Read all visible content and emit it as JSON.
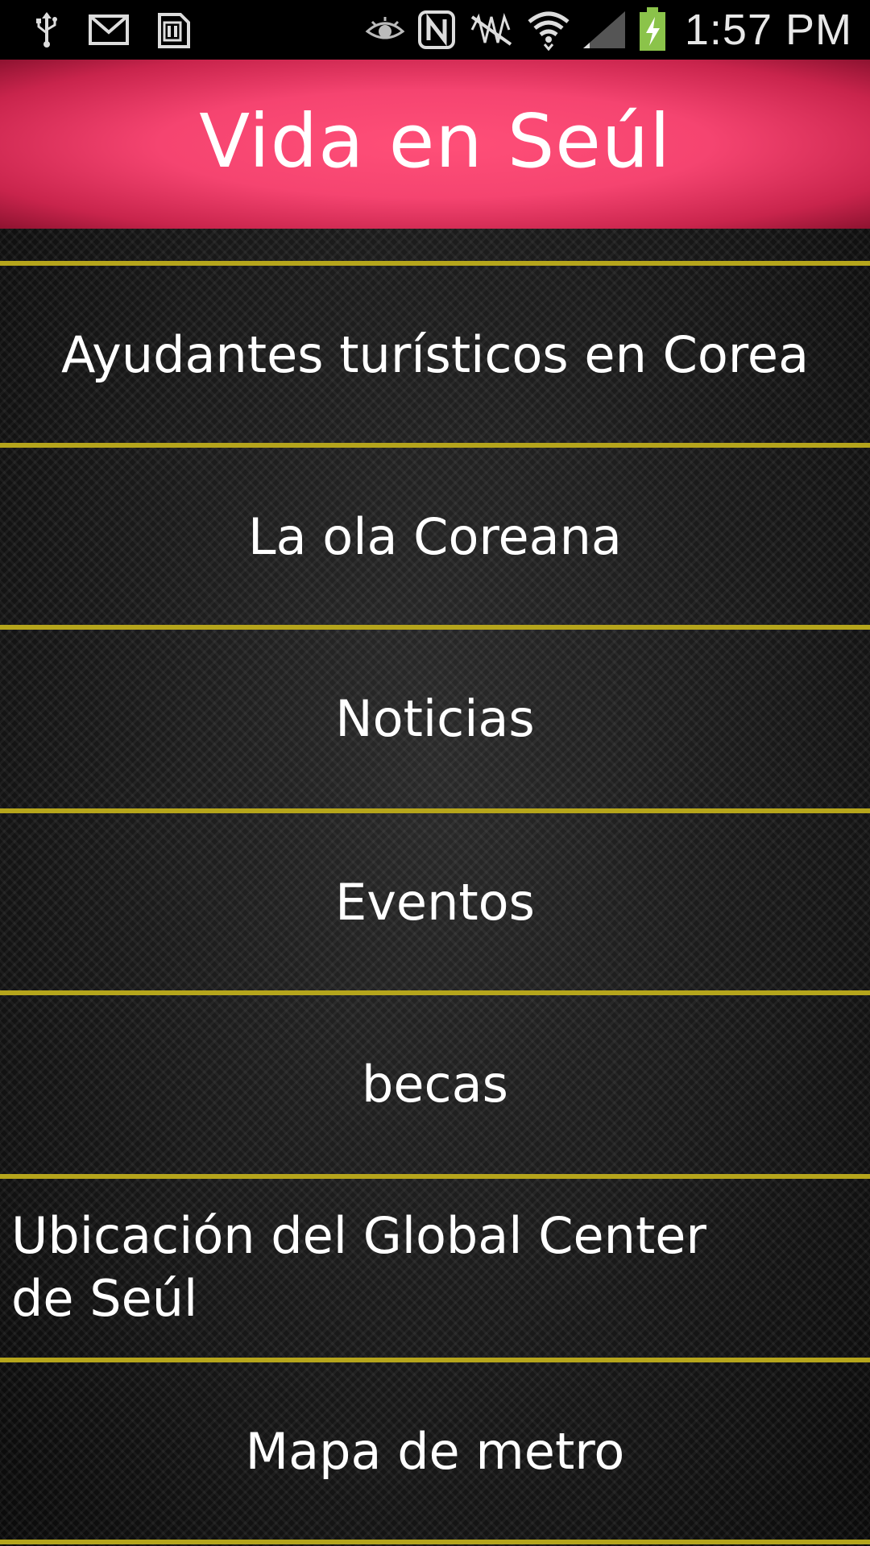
{
  "status_bar": {
    "time": "1:57 PM",
    "icons": [
      "usb-icon",
      "gmail-icon",
      "sd-card-icon",
      "eye-icon",
      "nfc-icon",
      "mute-icon",
      "wifi-icon",
      "signal-icon",
      "battery-charging-icon"
    ]
  },
  "header": {
    "title": "Vida en Seúl"
  },
  "menu": {
    "items": [
      {
        "label": "Ayudantes turísticos en Corea"
      },
      {
        "label": "La ola Coreana"
      },
      {
        "label": "Noticias"
      },
      {
        "label": "Eventos"
      },
      {
        "label": "becas"
      },
      {
        "label": "Ubicación del Global Center de Seúl"
      },
      {
        "label": "Mapa de metro"
      }
    ]
  },
  "colors": {
    "header_accent": "#f54470",
    "divider": "#b5a51c",
    "battery": "#8bc34a"
  }
}
